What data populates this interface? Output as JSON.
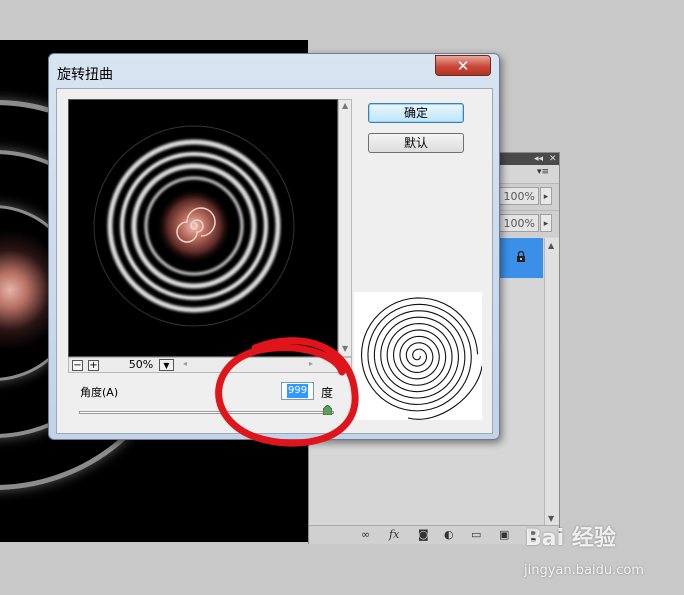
{
  "dialog": {
    "title": "旋转扭曲",
    "close_label": "✕",
    "ok_label": "确定",
    "default_label": "默认",
    "zoom": {
      "value": "50%",
      "minus": "−",
      "plus": "+"
    },
    "angle": {
      "label": "角度(A)",
      "value": "999",
      "unit": "度"
    }
  },
  "layers_panel": {
    "opacity": "100%",
    "fill": "100%",
    "collapse_icon": "◂◂",
    "close_icon": "✕",
    "menu_icon": "▾≡",
    "footer_icons": [
      "link-icon",
      "fx-icon",
      "mask-icon",
      "adjustment-icon",
      "group-folder-icon",
      "new-layer-icon",
      "trash-icon"
    ]
  },
  "watermark": {
    "logo": "Bai 经验",
    "url": "jingyan.baidu.com"
  },
  "colors": {
    "annotation": "#e0151c",
    "selection": "#3a90e8",
    "close_button": "#c9483a"
  }
}
